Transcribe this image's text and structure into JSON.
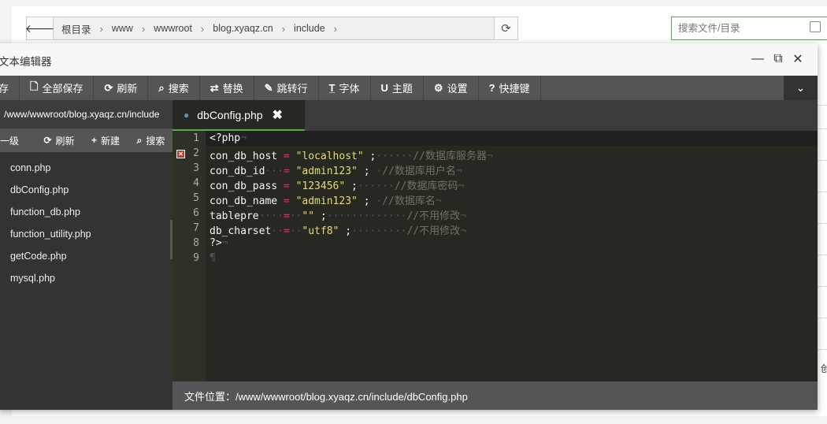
{
  "background": {
    "breadcrumbs": [
      "根目录",
      "www",
      "wwwroot",
      "blog.xyaqz.cn",
      "include"
    ],
    "search_placeholder": "搜索文件/目录",
    "side_char": "创"
  },
  "editor": {
    "title": "文本编辑器",
    "toolbar": {
      "save": "存",
      "save_all": "全部保存",
      "refresh": "刷新",
      "search": "搜索",
      "replace": "替换",
      "goto_line": "跳转行",
      "font": "字体",
      "theme": "主题",
      "settings": "设置",
      "shortcuts": "快捷键"
    },
    "sidebar": {
      "path": "/www/wwwroot/blog.xyaqz.cn/include",
      "up": "一级",
      "refresh": "刷新",
      "new": "新建",
      "search": "搜索",
      "files": [
        "conn.php",
        "dbConfig.php",
        "function_db.php",
        "function_utility.php",
        "getCode.php",
        "mysql.php"
      ]
    },
    "tab": {
      "label": "dbConfig.php",
      "close": "✖"
    },
    "code": {
      "line_numbers": [
        "1",
        "2",
        "3",
        "4",
        "5",
        "6",
        "7",
        "8",
        "9"
      ],
      "lines": [
        [
          {
            "t": "kw",
            "v": "<?php"
          },
          {
            "t": "ws",
            "v": "¬"
          }
        ],
        [
          {
            "t": "kw",
            "v": "con_db_host"
          },
          {
            "t": "ws",
            "v": " "
          },
          {
            "t": "op",
            "v": "="
          },
          {
            "t": "ws",
            "v": " "
          },
          {
            "t": "str",
            "v": "\"localhost\""
          },
          {
            "t": "ws",
            "v": " "
          },
          {
            "t": "kw",
            "v": ";"
          },
          {
            "t": "ws",
            "v": "······"
          },
          {
            "t": "cm",
            "v": "//数据库服务器"
          },
          {
            "t": "ws",
            "v": "¬"
          }
        ],
        [
          {
            "t": "kw",
            "v": "con_db_id"
          },
          {
            "t": "ws",
            "v": "···"
          },
          {
            "t": "op",
            "v": "="
          },
          {
            "t": "ws",
            "v": " "
          },
          {
            "t": "str",
            "v": "\"admin123\""
          },
          {
            "t": "ws",
            "v": " "
          },
          {
            "t": "kw",
            "v": ";"
          },
          {
            "t": "ws",
            "v": " ·"
          },
          {
            "t": "cm",
            "v": "//数据库用户名"
          },
          {
            "t": "ws",
            "v": "¬"
          }
        ],
        [
          {
            "t": "kw",
            "v": "con_db_pass"
          },
          {
            "t": "ws",
            "v": " "
          },
          {
            "t": "op",
            "v": "="
          },
          {
            "t": "ws",
            "v": " "
          },
          {
            "t": "str",
            "v": "\"123456\""
          },
          {
            "t": "ws",
            "v": " "
          },
          {
            "t": "kw",
            "v": ";"
          },
          {
            "t": "ws",
            "v": "······"
          },
          {
            "t": "cm",
            "v": "//数据库密码"
          },
          {
            "t": "ws",
            "v": "¬"
          }
        ],
        [
          {
            "t": "kw",
            "v": "con_db_name"
          },
          {
            "t": "ws",
            "v": " "
          },
          {
            "t": "op",
            "v": "="
          },
          {
            "t": "ws",
            "v": " "
          },
          {
            "t": "str",
            "v": "\"admin123\""
          },
          {
            "t": "ws",
            "v": " "
          },
          {
            "t": "kw",
            "v": ";"
          },
          {
            "t": "ws",
            "v": " ·"
          },
          {
            "t": "cm",
            "v": "//数据库名"
          },
          {
            "t": "ws",
            "v": "¬"
          }
        ],
        [
          {
            "t": "kw",
            "v": "tablepre"
          },
          {
            "t": "ws",
            "v": "····"
          },
          {
            "t": "op",
            "v": "="
          },
          {
            "t": "ws",
            "v": "··"
          },
          {
            "t": "str",
            "v": "\"\""
          },
          {
            "t": "ws",
            "v": " "
          },
          {
            "t": "kw",
            "v": ";"
          },
          {
            "t": "ws",
            "v": "·············"
          },
          {
            "t": "cm",
            "v": "//不用修改"
          },
          {
            "t": "ws",
            "v": "¬"
          }
        ],
        [
          {
            "t": "kw",
            "v": "db_charset"
          },
          {
            "t": "ws",
            "v": "··"
          },
          {
            "t": "op",
            "v": "="
          },
          {
            "t": "ws",
            "v": "··"
          },
          {
            "t": "str",
            "v": "\"utf8\""
          },
          {
            "t": "ws",
            "v": " "
          },
          {
            "t": "kw",
            "v": ";"
          },
          {
            "t": "ws",
            "v": "·········"
          },
          {
            "t": "cm",
            "v": "//不用修改"
          },
          {
            "t": "ws",
            "v": "¬"
          }
        ],
        [
          {
            "t": "kw",
            "v": "?>"
          },
          {
            "t": "ws",
            "v": "¬"
          }
        ],
        [
          {
            "t": "ws",
            "v": "¶"
          }
        ]
      ]
    },
    "status": "文件位置：/www/wwwroot/blog.xyaqz.cn/include/dbConfig.php"
  },
  "colors": {
    "accent": "#4caf50",
    "error": "#c0392b",
    "editor_bg": "#272822"
  }
}
